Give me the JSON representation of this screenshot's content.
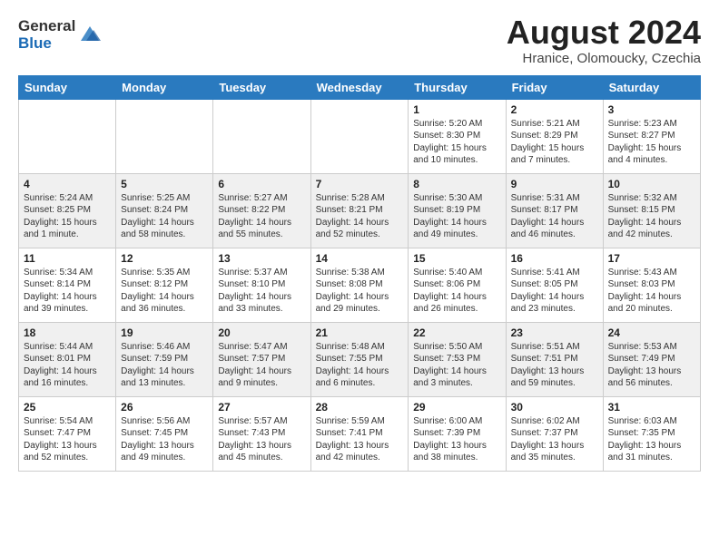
{
  "logo": {
    "general": "General",
    "blue": "Blue"
  },
  "title": "August 2024",
  "location": "Hranice, Olomoucky, Czechia",
  "days_of_week": [
    "Sunday",
    "Monday",
    "Tuesday",
    "Wednesday",
    "Thursday",
    "Friday",
    "Saturday"
  ],
  "weeks": [
    [
      {
        "day": "",
        "info": ""
      },
      {
        "day": "",
        "info": ""
      },
      {
        "day": "",
        "info": ""
      },
      {
        "day": "",
        "info": ""
      },
      {
        "day": "1",
        "info": "Sunrise: 5:20 AM\nSunset: 8:30 PM\nDaylight: 15 hours\nand 10 minutes."
      },
      {
        "day": "2",
        "info": "Sunrise: 5:21 AM\nSunset: 8:29 PM\nDaylight: 15 hours\nand 7 minutes."
      },
      {
        "day": "3",
        "info": "Sunrise: 5:23 AM\nSunset: 8:27 PM\nDaylight: 15 hours\nand 4 minutes."
      }
    ],
    [
      {
        "day": "4",
        "info": "Sunrise: 5:24 AM\nSunset: 8:25 PM\nDaylight: 15 hours\nand 1 minute."
      },
      {
        "day": "5",
        "info": "Sunrise: 5:25 AM\nSunset: 8:24 PM\nDaylight: 14 hours\nand 58 minutes."
      },
      {
        "day": "6",
        "info": "Sunrise: 5:27 AM\nSunset: 8:22 PM\nDaylight: 14 hours\nand 55 minutes."
      },
      {
        "day": "7",
        "info": "Sunrise: 5:28 AM\nSunset: 8:21 PM\nDaylight: 14 hours\nand 52 minutes."
      },
      {
        "day": "8",
        "info": "Sunrise: 5:30 AM\nSunset: 8:19 PM\nDaylight: 14 hours\nand 49 minutes."
      },
      {
        "day": "9",
        "info": "Sunrise: 5:31 AM\nSunset: 8:17 PM\nDaylight: 14 hours\nand 46 minutes."
      },
      {
        "day": "10",
        "info": "Sunrise: 5:32 AM\nSunset: 8:15 PM\nDaylight: 14 hours\nand 42 minutes."
      }
    ],
    [
      {
        "day": "11",
        "info": "Sunrise: 5:34 AM\nSunset: 8:14 PM\nDaylight: 14 hours\nand 39 minutes."
      },
      {
        "day": "12",
        "info": "Sunrise: 5:35 AM\nSunset: 8:12 PM\nDaylight: 14 hours\nand 36 minutes."
      },
      {
        "day": "13",
        "info": "Sunrise: 5:37 AM\nSunset: 8:10 PM\nDaylight: 14 hours\nand 33 minutes."
      },
      {
        "day": "14",
        "info": "Sunrise: 5:38 AM\nSunset: 8:08 PM\nDaylight: 14 hours\nand 29 minutes."
      },
      {
        "day": "15",
        "info": "Sunrise: 5:40 AM\nSunset: 8:06 PM\nDaylight: 14 hours\nand 26 minutes."
      },
      {
        "day": "16",
        "info": "Sunrise: 5:41 AM\nSunset: 8:05 PM\nDaylight: 14 hours\nand 23 minutes."
      },
      {
        "day": "17",
        "info": "Sunrise: 5:43 AM\nSunset: 8:03 PM\nDaylight: 14 hours\nand 20 minutes."
      }
    ],
    [
      {
        "day": "18",
        "info": "Sunrise: 5:44 AM\nSunset: 8:01 PM\nDaylight: 14 hours\nand 16 minutes."
      },
      {
        "day": "19",
        "info": "Sunrise: 5:46 AM\nSunset: 7:59 PM\nDaylight: 14 hours\nand 13 minutes."
      },
      {
        "day": "20",
        "info": "Sunrise: 5:47 AM\nSunset: 7:57 PM\nDaylight: 14 hours\nand 9 minutes."
      },
      {
        "day": "21",
        "info": "Sunrise: 5:48 AM\nSunset: 7:55 PM\nDaylight: 14 hours\nand 6 minutes."
      },
      {
        "day": "22",
        "info": "Sunrise: 5:50 AM\nSunset: 7:53 PM\nDaylight: 14 hours\nand 3 minutes."
      },
      {
        "day": "23",
        "info": "Sunrise: 5:51 AM\nSunset: 7:51 PM\nDaylight: 13 hours\nand 59 minutes."
      },
      {
        "day": "24",
        "info": "Sunrise: 5:53 AM\nSunset: 7:49 PM\nDaylight: 13 hours\nand 56 minutes."
      }
    ],
    [
      {
        "day": "25",
        "info": "Sunrise: 5:54 AM\nSunset: 7:47 PM\nDaylight: 13 hours\nand 52 minutes."
      },
      {
        "day": "26",
        "info": "Sunrise: 5:56 AM\nSunset: 7:45 PM\nDaylight: 13 hours\nand 49 minutes."
      },
      {
        "day": "27",
        "info": "Sunrise: 5:57 AM\nSunset: 7:43 PM\nDaylight: 13 hours\nand 45 minutes."
      },
      {
        "day": "28",
        "info": "Sunrise: 5:59 AM\nSunset: 7:41 PM\nDaylight: 13 hours\nand 42 minutes."
      },
      {
        "day": "29",
        "info": "Sunrise: 6:00 AM\nSunset: 7:39 PM\nDaylight: 13 hours\nand 38 minutes."
      },
      {
        "day": "30",
        "info": "Sunrise: 6:02 AM\nSunset: 7:37 PM\nDaylight: 13 hours\nand 35 minutes."
      },
      {
        "day": "31",
        "info": "Sunrise: 6:03 AM\nSunset: 7:35 PM\nDaylight: 13 hours\nand 31 minutes."
      }
    ]
  ]
}
